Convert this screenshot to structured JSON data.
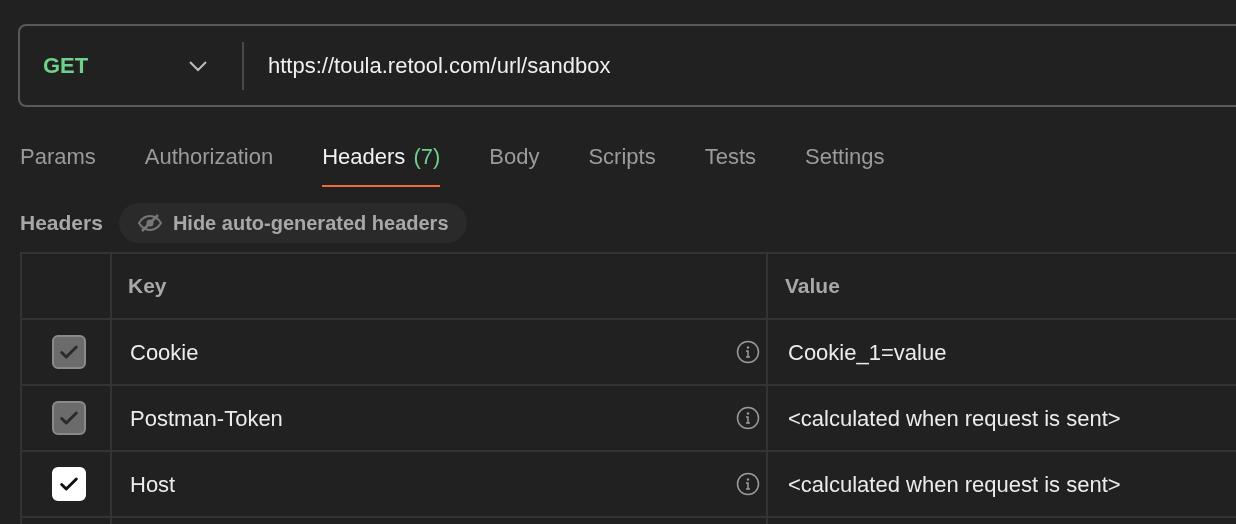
{
  "request": {
    "method": "GET",
    "url": "https://toula.retool.com/url/sandbox"
  },
  "tabs": [
    {
      "label": "Params",
      "selected": false
    },
    {
      "label": "Authorization",
      "selected": false
    },
    {
      "label": "Headers",
      "count": "(7)",
      "selected": true
    },
    {
      "label": "Body",
      "selected": false
    },
    {
      "label": "Scripts",
      "selected": false
    },
    {
      "label": "Tests",
      "selected": false
    },
    {
      "label": "Settings",
      "selected": false
    }
  ],
  "section": {
    "title": "Headers",
    "toggle": "Hide auto-generated headers"
  },
  "table": {
    "columns": [
      "Key",
      "Value"
    ],
    "rows": [
      {
        "checked": true,
        "disabled": true,
        "key": "Cookie",
        "value": "Cookie_1=value"
      },
      {
        "checked": true,
        "disabled": true,
        "key": "Postman-Token",
        "value": "<calculated when request is sent>"
      },
      {
        "checked": true,
        "disabled": false,
        "key": "Host",
        "value": "<calculated when request is sent>"
      }
    ]
  }
}
